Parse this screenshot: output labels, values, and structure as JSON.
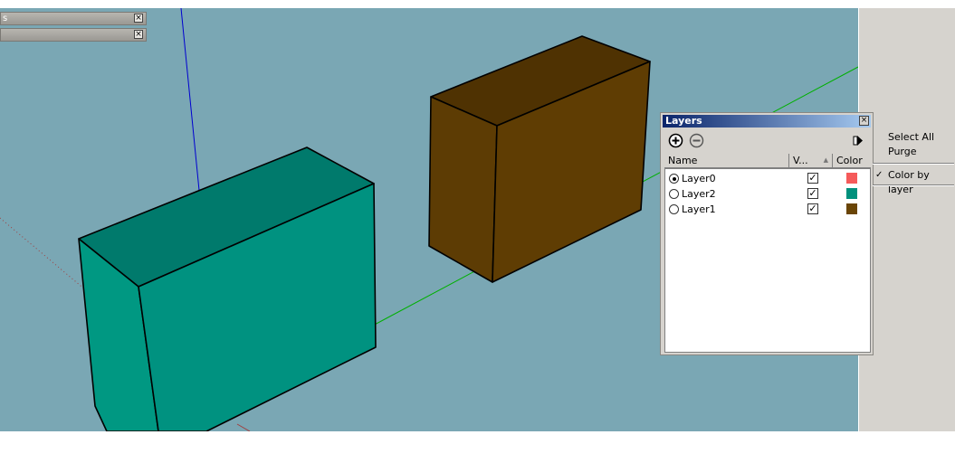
{
  "colors": {
    "sky": "#7aa7b4",
    "teal_box": "#008c78",
    "brown_box": "#5e3c03",
    "axis_blue": "#0000d0",
    "axis_green": "#00b000",
    "axis_red": "#a04040"
  },
  "trays": [
    {
      "title": "s",
      "close": "×"
    },
    {
      "title": "",
      "close": "×"
    }
  ],
  "layers_dialog": {
    "title": "Layers",
    "close": "×",
    "add_icon": "plus-circle-icon",
    "delete_icon": "minus-circle-icon",
    "details_icon": "details-arrow-icon",
    "columns": {
      "name": "Name",
      "visible": "V...",
      "sort": "▲",
      "color": "Color"
    },
    "rows": [
      {
        "name": "Layer0",
        "active": true,
        "visible": "✓",
        "color": "#f55a5a"
      },
      {
        "name": "Layer2",
        "active": false,
        "visible": "✓",
        "color": "#00907c"
      },
      {
        "name": "Layer1",
        "active": false,
        "visible": "✓",
        "color": "#6a4506"
      }
    ]
  },
  "details_menu": {
    "select_all": "Select All",
    "purge": "Purge",
    "color_by_layer": "Color by layer",
    "checkmark": "✓"
  }
}
